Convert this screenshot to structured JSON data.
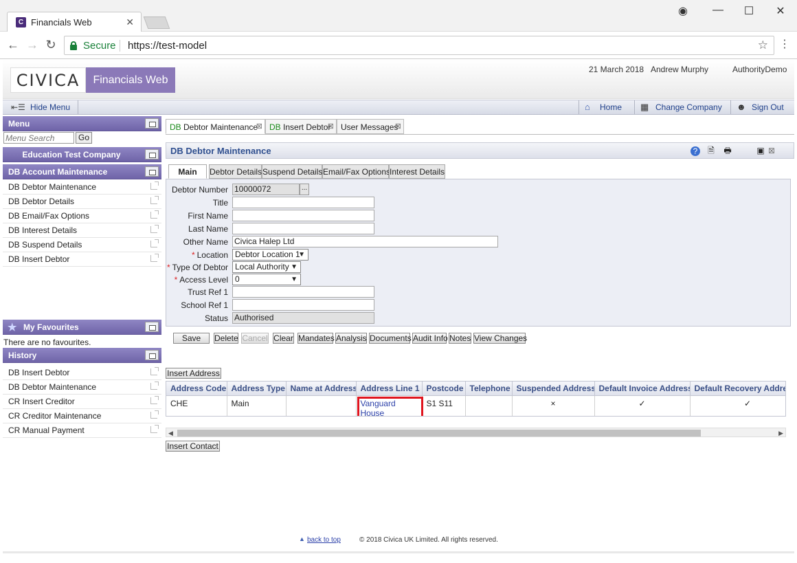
{
  "browser": {
    "tab_title": "Financials Web",
    "tab_close": "✕",
    "favicon": "C",
    "secure_label": "Secure",
    "url": "https://test-model",
    "controls": {
      "user": "◉",
      "minimize": "—",
      "maximize": "☐",
      "close": "✕"
    },
    "nav": {
      "back": "←",
      "forward": "→",
      "reload": "↻",
      "star": "☆",
      "menu": "⋮"
    }
  },
  "header": {
    "logo_text": "CIVICA",
    "product_name": "Financials Web",
    "date": "21 March 2018",
    "user": "Andrew Murphy",
    "authority": "AuthorityDemo"
  },
  "toolbar": {
    "hide_menu": "Hide Menu",
    "home": "Home",
    "change_company": "Change Company",
    "sign_out": "Sign Out"
  },
  "sidebar": {
    "menu_title": "Menu",
    "menu_search_placeholder": "Menu Search",
    "go_label": "Go",
    "company": "Education Test Company",
    "section_title": "DB Account Maintenance",
    "items": [
      {
        "label": "DB Debtor Maintenance"
      },
      {
        "label": "DB Debtor Details"
      },
      {
        "label": "DB Email/Fax Options"
      },
      {
        "label": "DB Interest Details"
      },
      {
        "label": "DB Suspend Details"
      },
      {
        "label": "DB Insert Debtor"
      }
    ],
    "favourites_title": "My Favourites",
    "no_favourites": "There are no favourites.",
    "history_title": "History",
    "history": [
      {
        "label": "DB Insert Debtor"
      },
      {
        "label": "DB Debtor Maintenance"
      },
      {
        "label": "CR Insert Creditor"
      },
      {
        "label": "CR Creditor Maintenance"
      },
      {
        "label": "CR Manual Payment"
      }
    ]
  },
  "doc_tabs": [
    {
      "prefix": "DB",
      "label": " Debtor Maintenance"
    },
    {
      "prefix": "DB",
      "label": " Insert Debtor"
    },
    {
      "prefix": "",
      "label": "User Messages"
    }
  ],
  "page_title": "DB Debtor Maintenance",
  "page_icons": {
    "help": "?",
    "export": "🗎",
    "print": "🖶",
    "window": "▣"
  },
  "sub_tabs": [
    "Main",
    "Debtor Details",
    "Suspend Details",
    "Email/Fax Options",
    "Interest Details"
  ],
  "form": {
    "debtor_number_label": "Debtor Number",
    "debtor_number": "10000072",
    "lookup_label": "...",
    "title_label": "Title",
    "title_value": "",
    "first_name_label": "First Name",
    "first_name_value": "",
    "last_name_label": "Last Name",
    "last_name_value": "",
    "other_name_label": "Other Name",
    "other_name_value": "Civica Halep Ltd",
    "location_label": "Location",
    "location_value": "Debtor Location 1",
    "type_label": "Type Of Debtor",
    "type_value": "Local Authority",
    "access_label": "Access Level",
    "access_value": "0",
    "trust_label": "Trust Ref 1",
    "trust_value": "",
    "school_label": "School Ref 1",
    "school_value": "",
    "status_label": "Status",
    "status_value": "Authorised",
    "required_marker": "*",
    "dropdown_arrow": "▼"
  },
  "actions": {
    "save": "Save",
    "delete": "Delete",
    "cancel": "Cancel",
    "clear": "Clear",
    "mandates": "Mandates",
    "analysis": "Analysis",
    "documents": "Documents",
    "audit": "Audit Info",
    "notes": "Notes",
    "view_changes": "View Changes"
  },
  "insert_address": "Insert Address",
  "insert_contact": "Insert Contact",
  "address_table": {
    "headers": [
      "Address Code",
      "Address Type",
      "Name at Address",
      "Address Line 1",
      "Postcode",
      "Telephone",
      "Suspended Address",
      "Default Invoice Address",
      "Default Recovery Address"
    ],
    "rows": [
      {
        "code": "CHE",
        "type": "Main",
        "name": "",
        "line1_a": "Vanguard",
        "line1_b": "House",
        "postcode": "S1 S11",
        "telephone": "",
        "suspended": "×",
        "default_invoice": "✓",
        "default_recovery": "✓"
      }
    ]
  },
  "footer": {
    "back_to_top": "back to top",
    "back_arrow": "▲",
    "copyright": "© 2018 Civica UK Limited. All rights reserved."
  },
  "colors": {
    "brand_purple": "#8b79b8",
    "panel_header": "#6f64a8",
    "secure_green": "#188038",
    "highlight_red": "#e0141e"
  }
}
